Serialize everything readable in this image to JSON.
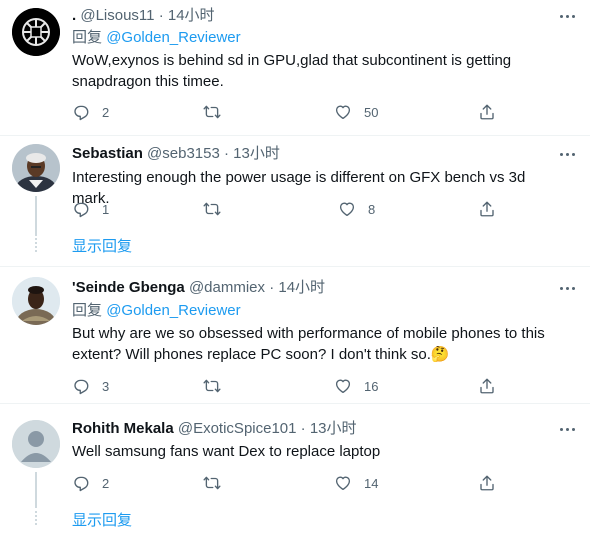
{
  "tweets": [
    {
      "name": ".",
      "handle": "@Lisous11",
      "sep": "·",
      "time": "14小时",
      "reply_label": "回复",
      "reply_mention": "@Golden_Reviewer",
      "text": "WoW,exynos is behind sd in GPU,glad that subcontinent is getting snapdragon this timee.",
      "replies": "2",
      "retweets": "",
      "likes": "50"
    },
    {
      "name": "Sebastian",
      "handle": "@seb3153",
      "sep": "·",
      "time": "13小时",
      "text": "Interesting enough the power usage is different on GFX bench vs 3d mark.",
      "replies": "1",
      "retweets": "",
      "likes": "8",
      "show_replies": "显示回复"
    },
    {
      "name": "'Seinde Gbenga",
      "handle": "@dammiex",
      "sep": "·",
      "time": "14小时",
      "reply_label": "回复",
      "reply_mention": "@Golden_Reviewer",
      "text": "But why are we so obsessed with performance of mobile phones to this extent? Will phones replace PC soon? I don't think so.",
      "emoji": "🤔",
      "replies": "3",
      "retweets": "",
      "likes": "16"
    },
    {
      "name": "Rohith Mekala",
      "handle": "@ExoticSpice101",
      "sep": "·",
      "time": "13小时",
      "text": "Well samsung fans want Dex to replace laptop",
      "replies": "2",
      "retweets": "",
      "likes": "14",
      "show_replies": "显示回复"
    }
  ],
  "icons": {
    "reply": "reply-icon",
    "retweet": "retweet-icon",
    "like": "heart-icon",
    "share": "share-icon",
    "more": "more-icon"
  },
  "colors": {
    "accent": "#1d9bf0",
    "secondary_text": "#536471",
    "thread_line": "#cfd9de",
    "divider": "#eff3f4"
  }
}
